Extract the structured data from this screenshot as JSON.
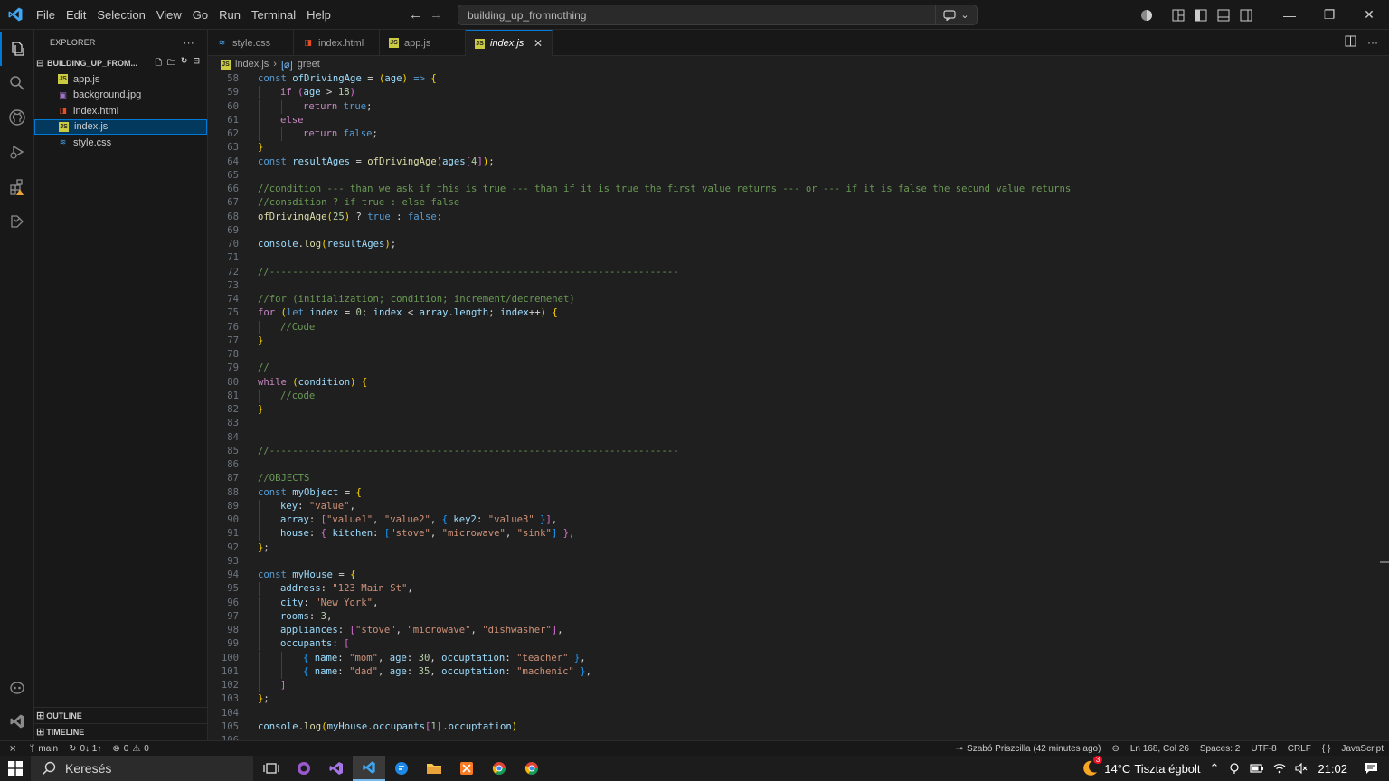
{
  "titlebar": {
    "menus": [
      "File",
      "Edit",
      "Selection",
      "View",
      "Go",
      "Run",
      "Terminal",
      "Help"
    ],
    "search_text": "building_up_fromnothing",
    "window_controls": [
      "minimize",
      "restore",
      "close"
    ]
  },
  "activity_icons": [
    "explorer-icon",
    "search-icon",
    "github-icon",
    "run-debug-icon",
    "extensions-icon",
    "testing-icon",
    "copilot-icon",
    "vscode-icon"
  ],
  "sidebar": {
    "title": "EXPLORER",
    "more": "···",
    "project": "BUILDING_UP_FROM...",
    "files": [
      {
        "name": "app.js",
        "icon": "js",
        "color": "#cbcb41",
        "selected": false
      },
      {
        "name": "background.jpg",
        "icon": "image",
        "color": "#a074c4",
        "selected": false
      },
      {
        "name": "index.html",
        "icon": "html",
        "color": "#e44d26",
        "selected": false
      },
      {
        "name": "index.js",
        "icon": "js",
        "color": "#cbcb41",
        "selected": true
      },
      {
        "name": "style.css",
        "icon": "css",
        "color": "#42a5f5",
        "selected": false
      }
    ],
    "outline": "OUTLINE",
    "timeline": "TIMELINE"
  },
  "tabs": [
    {
      "label": "style.css",
      "icon": "css",
      "color": "#42a5f5",
      "active": false
    },
    {
      "label": "index.html",
      "icon": "html",
      "color": "#e44d26",
      "active": false
    },
    {
      "label": "app.js",
      "icon": "js",
      "color": "#cbcb41",
      "active": false
    },
    {
      "label": "index.js",
      "icon": "js",
      "color": "#cbcb41",
      "active": true
    }
  ],
  "breadcrumb": {
    "file": "index.js",
    "symbol": "greet"
  },
  "code_lines": [
    {
      "n": "58",
      "t": [
        [
          "k",
          "const "
        ],
        [
          "v",
          "ofDrivingAge"
        ],
        [
          "p",
          " = "
        ],
        [
          "b1",
          "("
        ],
        [
          "v",
          "age"
        ],
        [
          "b1",
          ")"
        ],
        [
          "k",
          " => "
        ],
        [
          "b1",
          "{"
        ]
      ]
    },
    {
      "n": "59",
      "i": 1,
      "t": [
        [
          "c",
          "if "
        ],
        [
          "b2",
          "("
        ],
        [
          "v",
          "age"
        ],
        [
          "p",
          " > "
        ],
        [
          "n",
          "18"
        ],
        [
          "b2",
          ")"
        ]
      ]
    },
    {
      "n": "60",
      "i": 2,
      "t": [
        [
          "c",
          "return "
        ],
        [
          "k",
          "true"
        ],
        [
          "p",
          ";"
        ]
      ]
    },
    {
      "n": "61",
      "i": 1,
      "t": [
        [
          "c",
          "else"
        ]
      ]
    },
    {
      "n": "62",
      "i": 2,
      "t": [
        [
          "c",
          "return "
        ],
        [
          "k",
          "false"
        ],
        [
          "p",
          ";"
        ]
      ]
    },
    {
      "n": "63",
      "t": [
        [
          "b1",
          "}"
        ]
      ]
    },
    {
      "n": "64",
      "t": [
        [
          "k",
          "const "
        ],
        [
          "v",
          "resultAges"
        ],
        [
          "p",
          " = "
        ],
        [
          "f",
          "ofDrivingAge"
        ],
        [
          "b1",
          "("
        ],
        [
          "v",
          "ages"
        ],
        [
          "b2",
          "["
        ],
        [
          "n",
          "4"
        ],
        [
          "b2",
          "]"
        ],
        [
          "b1",
          ")"
        ],
        [
          "p",
          ";"
        ]
      ]
    },
    {
      "n": "65",
      "t": []
    },
    {
      "n": "66",
      "t": [
        [
          "cm",
          "//condition --- than we ask if this is true --- than if it is true the first value returns --- or --- if it is false the secund value returns"
        ]
      ]
    },
    {
      "n": "67",
      "t": [
        [
          "cm",
          "//consdition ? if true : else false"
        ]
      ]
    },
    {
      "n": "68",
      "t": [
        [
          "f",
          "ofDrivingAge"
        ],
        [
          "b1",
          "("
        ],
        [
          "n",
          "25"
        ],
        [
          "b1",
          ")"
        ],
        [
          "p",
          " ? "
        ],
        [
          "k",
          "true"
        ],
        [
          "p",
          " : "
        ],
        [
          "k",
          "false"
        ],
        [
          "p",
          ";"
        ]
      ]
    },
    {
      "n": "69",
      "t": []
    },
    {
      "n": "70",
      "t": [
        [
          "v",
          "console"
        ],
        [
          "p",
          "."
        ],
        [
          "f",
          "log"
        ],
        [
          "b1",
          "("
        ],
        [
          "v",
          "resultAges"
        ],
        [
          "b1",
          ")"
        ],
        [
          "p",
          ";"
        ]
      ]
    },
    {
      "n": "71",
      "t": []
    },
    {
      "n": "72",
      "t": [
        [
          "cm",
          "//-----------------------------------------------------------------------"
        ]
      ]
    },
    {
      "n": "73",
      "t": []
    },
    {
      "n": "74",
      "t": [
        [
          "cm",
          "//for (initialization; condition; increment/decremenet)"
        ]
      ]
    },
    {
      "n": "75",
      "t": [
        [
          "c",
          "for "
        ],
        [
          "b1",
          "("
        ],
        [
          "k",
          "let "
        ],
        [
          "v",
          "index"
        ],
        [
          "p",
          " = "
        ],
        [
          "n",
          "0"
        ],
        [
          "p",
          "; "
        ],
        [
          "v",
          "index"
        ],
        [
          "p",
          " < "
        ],
        [
          "v",
          "array"
        ],
        [
          "p",
          "."
        ],
        [
          "v",
          "length"
        ],
        [
          "p",
          "; "
        ],
        [
          "v",
          "index"
        ],
        [
          "p",
          "++"
        ],
        [
          "b1",
          ")"
        ],
        [
          "p",
          " "
        ],
        [
          "b1",
          "{"
        ]
      ]
    },
    {
      "n": "76",
      "i": 1,
      "t": [
        [
          "cm",
          "//Code"
        ]
      ]
    },
    {
      "n": "77",
      "t": [
        [
          "b1",
          "}"
        ]
      ]
    },
    {
      "n": "78",
      "t": []
    },
    {
      "n": "79",
      "t": [
        [
          "cm",
          "//"
        ]
      ]
    },
    {
      "n": "80",
      "t": [
        [
          "c",
          "while "
        ],
        [
          "b1",
          "("
        ],
        [
          "v",
          "condition"
        ],
        [
          "b1",
          ")"
        ],
        [
          "p",
          " "
        ],
        [
          "b1",
          "{"
        ]
      ]
    },
    {
      "n": "81",
      "i": 1,
      "t": [
        [
          "cm",
          "//code"
        ]
      ]
    },
    {
      "n": "82",
      "t": [
        [
          "b1",
          "}"
        ]
      ]
    },
    {
      "n": "83",
      "t": []
    },
    {
      "n": "84",
      "t": []
    },
    {
      "n": "85",
      "t": [
        [
          "cm",
          "//-----------------------------------------------------------------------"
        ]
      ]
    },
    {
      "n": "86",
      "t": []
    },
    {
      "n": "87",
      "t": [
        [
          "cm",
          "//OBJECTS"
        ]
      ]
    },
    {
      "n": "88",
      "t": [
        [
          "k",
          "const "
        ],
        [
          "v",
          "myObject"
        ],
        [
          "p",
          " = "
        ],
        [
          "b1",
          "{"
        ]
      ]
    },
    {
      "n": "89",
      "i": 1,
      "t": [
        [
          "v",
          "key"
        ],
        [
          "p",
          ": "
        ],
        [
          "s",
          "\"value\""
        ],
        [
          "p",
          ","
        ]
      ]
    },
    {
      "n": "90",
      "i": 1,
      "t": [
        [
          "v",
          "array"
        ],
        [
          "p",
          ": "
        ],
        [
          "b2",
          "["
        ],
        [
          "s",
          "\"value1\""
        ],
        [
          "p",
          ", "
        ],
        [
          "s",
          "\"value2\""
        ],
        [
          "p",
          ", "
        ],
        [
          "b3",
          "{"
        ],
        [
          "p",
          " "
        ],
        [
          "v",
          "key2"
        ],
        [
          "p",
          ": "
        ],
        [
          "s",
          "\"value3\""
        ],
        [
          "p",
          " "
        ],
        [
          "b3",
          "}"
        ],
        [
          "b2",
          "]"
        ],
        [
          "p",
          ","
        ]
      ]
    },
    {
      "n": "91",
      "i": 1,
      "t": [
        [
          "v",
          "house"
        ],
        [
          "p",
          ": "
        ],
        [
          "b2",
          "{"
        ],
        [
          "p",
          " "
        ],
        [
          "v",
          "kitchen"
        ],
        [
          "p",
          ": "
        ],
        [
          "b3",
          "["
        ],
        [
          "s",
          "\"stove\""
        ],
        [
          "p",
          ", "
        ],
        [
          "s",
          "\"microwave\""
        ],
        [
          "p",
          ", "
        ],
        [
          "s",
          "\"sink\""
        ],
        [
          "b3",
          "]"
        ],
        [
          "p",
          " "
        ],
        [
          "b2",
          "}"
        ],
        [
          "p",
          ","
        ]
      ]
    },
    {
      "n": "92",
      "t": [
        [
          "b1",
          "}"
        ],
        [
          "p",
          ";"
        ]
      ]
    },
    {
      "n": "93",
      "t": []
    },
    {
      "n": "94",
      "t": [
        [
          "k",
          "const "
        ],
        [
          "v",
          "myHouse"
        ],
        [
          "p",
          " = "
        ],
        [
          "b1",
          "{"
        ]
      ]
    },
    {
      "n": "95",
      "i": 1,
      "t": [
        [
          "v",
          "address"
        ],
        [
          "p",
          ": "
        ],
        [
          "s",
          "\"123 Main St\""
        ],
        [
          "p",
          ","
        ]
      ]
    },
    {
      "n": "96",
      "i": 1,
      "t": [
        [
          "v",
          "city"
        ],
        [
          "p",
          ": "
        ],
        [
          "s",
          "\"New York\""
        ],
        [
          "p",
          ","
        ]
      ]
    },
    {
      "n": "97",
      "i": 1,
      "t": [
        [
          "v",
          "rooms"
        ],
        [
          "p",
          ": "
        ],
        [
          "n",
          "3"
        ],
        [
          "p",
          ","
        ]
      ]
    },
    {
      "n": "98",
      "i": 1,
      "t": [
        [
          "v",
          "appliances"
        ],
        [
          "p",
          ": "
        ],
        [
          "b2",
          "["
        ],
        [
          "s",
          "\"stove\""
        ],
        [
          "p",
          ", "
        ],
        [
          "s",
          "\"microwave\""
        ],
        [
          "p",
          ", "
        ],
        [
          "s",
          "\"dishwasher\""
        ],
        [
          "b2",
          "]"
        ],
        [
          "p",
          ","
        ]
      ]
    },
    {
      "n": "99",
      "i": 1,
      "t": [
        [
          "v",
          "occupants"
        ],
        [
          "p",
          ": "
        ],
        [
          "b2",
          "["
        ]
      ]
    },
    {
      "n": "100",
      "i": 2,
      "t": [
        [
          "b3",
          "{"
        ],
        [
          "p",
          " "
        ],
        [
          "v",
          "name"
        ],
        [
          "p",
          ": "
        ],
        [
          "s",
          "\"mom\""
        ],
        [
          "p",
          ", "
        ],
        [
          "v",
          "age"
        ],
        [
          "p",
          ": "
        ],
        [
          "n",
          "30"
        ],
        [
          "p",
          ", "
        ],
        [
          "v",
          "occuptation"
        ],
        [
          "p",
          ": "
        ],
        [
          "s",
          "\"teacher\""
        ],
        [
          "p",
          " "
        ],
        [
          "b3",
          "}"
        ],
        [
          "p",
          ","
        ]
      ]
    },
    {
      "n": "101",
      "i": 2,
      "t": [
        [
          "b3",
          "{"
        ],
        [
          "p",
          " "
        ],
        [
          "v",
          "name"
        ],
        [
          "p",
          ": "
        ],
        [
          "s",
          "\"dad\""
        ],
        [
          "p",
          ", "
        ],
        [
          "v",
          "age"
        ],
        [
          "p",
          ": "
        ],
        [
          "n",
          "35"
        ],
        [
          "p",
          ", "
        ],
        [
          "v",
          "occuptation"
        ],
        [
          "p",
          ": "
        ],
        [
          "s",
          "\"machenic\""
        ],
        [
          "p",
          " "
        ],
        [
          "b3",
          "}"
        ],
        [
          "p",
          ","
        ]
      ]
    },
    {
      "n": "102",
      "i": 1,
      "t": [
        [
          "b2",
          "]"
        ]
      ]
    },
    {
      "n": "103",
      "t": [
        [
          "b1",
          "}"
        ],
        [
          "p",
          ";"
        ]
      ]
    },
    {
      "n": "104",
      "t": []
    },
    {
      "n": "105",
      "t": [
        [
          "v",
          "console"
        ],
        [
          "p",
          "."
        ],
        [
          "f",
          "log"
        ],
        [
          "b1",
          "("
        ],
        [
          "v",
          "myHouse"
        ],
        [
          "p",
          "."
        ],
        [
          "v",
          "occupants"
        ],
        [
          "b2",
          "["
        ],
        [
          "n",
          "1"
        ],
        [
          "b2",
          "]"
        ],
        [
          "p",
          "."
        ],
        [
          "v",
          "occuptation"
        ],
        [
          "b1",
          ")"
        ]
      ]
    },
    {
      "n": "106",
      "t": []
    }
  ],
  "statusbar": {
    "branch": "main",
    "sync": "0↓ 1↑",
    "errors": "0",
    "warnings": "0",
    "blame": "Szabó Priszcilla (42 minutes ago)",
    "position": "Ln 168, Col 26",
    "spaces": "Spaces: 2",
    "encoding": "UTF-8",
    "eol": "CRLF",
    "language": "JavaScript"
  },
  "taskbar": {
    "search": "Keresés",
    "weather_temp": "14°C",
    "weather_text": "Tiszta égbolt",
    "weather_badge": "3",
    "time": "21:02"
  }
}
